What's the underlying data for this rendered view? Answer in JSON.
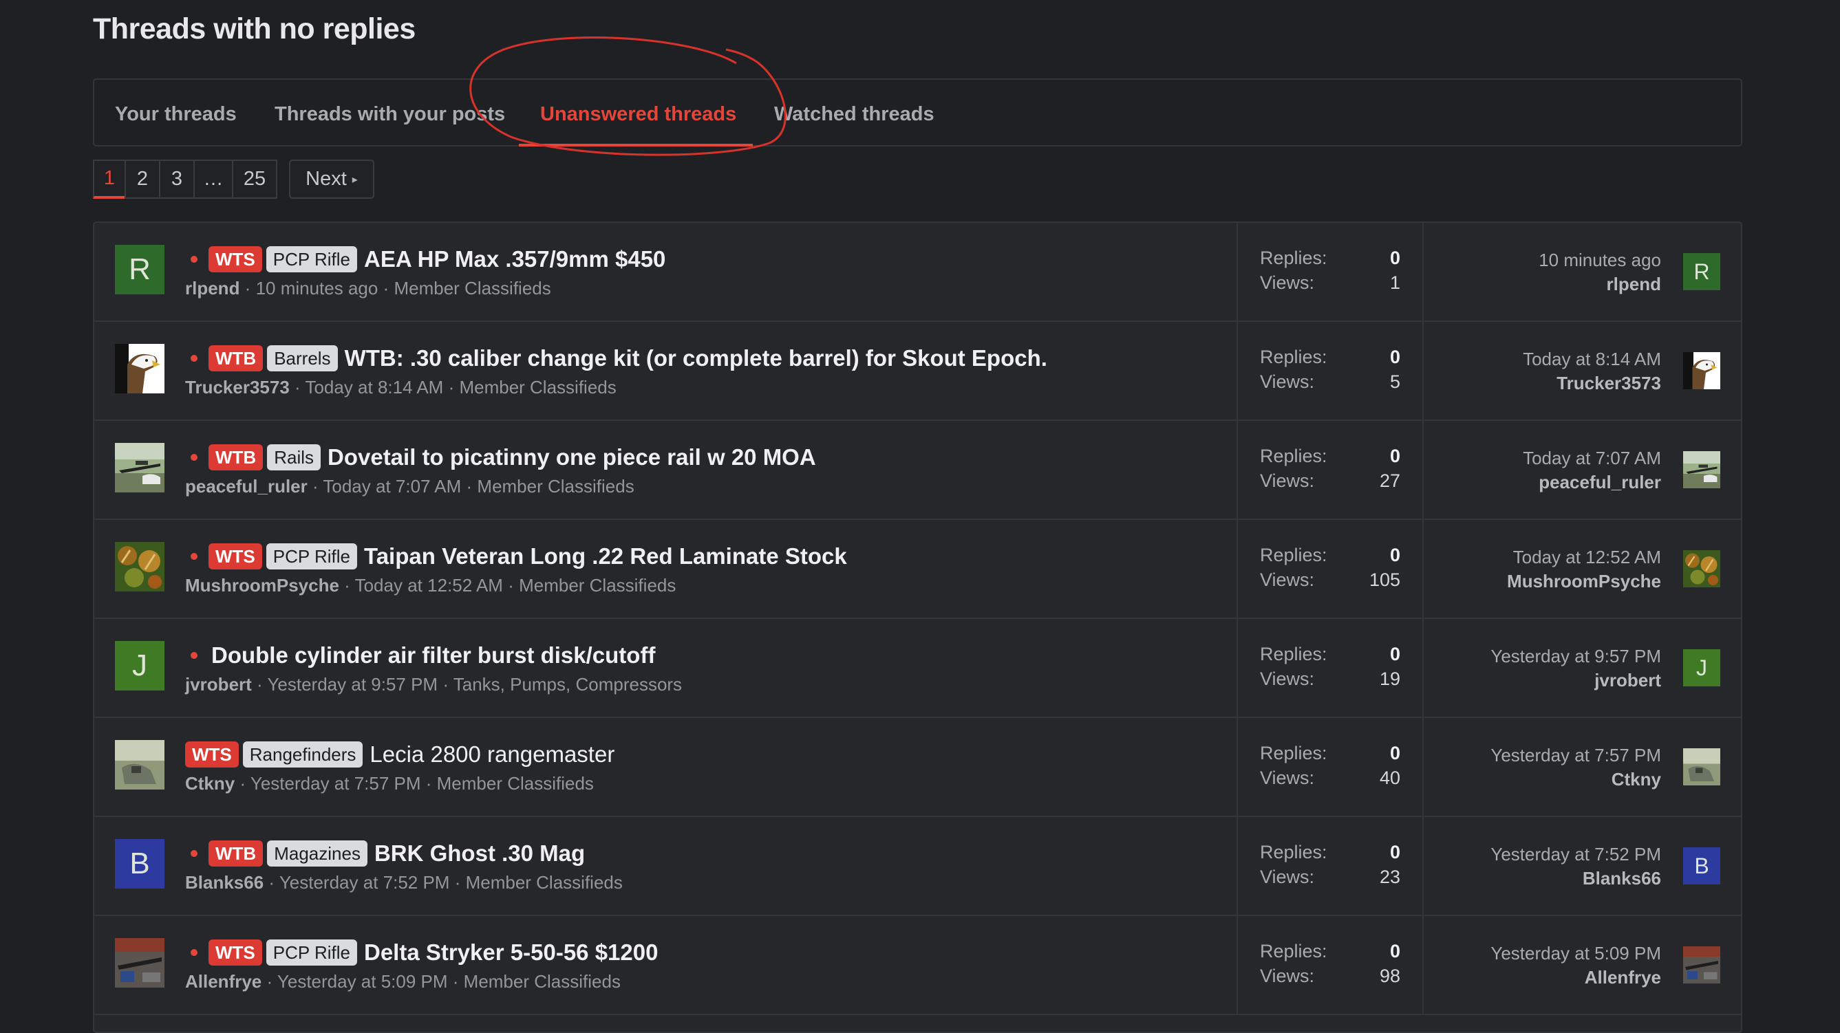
{
  "page": {
    "title": "Threads with no replies"
  },
  "tabs": [
    {
      "label": "Your threads"
    },
    {
      "label": "Threads with your posts"
    },
    {
      "label": "Unanswered threads",
      "active": true
    },
    {
      "label": "Watched threads"
    }
  ],
  "pagination": {
    "pages": [
      "1",
      "2",
      "3",
      "…",
      "25"
    ],
    "current": "1",
    "next_label": "Next",
    "next_icon": "chevron-right-icon"
  },
  "colors": {
    "accent": "#e5463a",
    "background": "#1f2024",
    "panel": "#26272b",
    "badge_red": "#dc3b33",
    "badge_grey": "#d9dbde"
  },
  "stats_labels": {
    "replies": "Replies:",
    "views": "Views:"
  },
  "threads": [
    {
      "avatar_letter": "R",
      "avatar_color": "#2e6a2a",
      "unread": true,
      "prefix": "WTS",
      "tag": "PCP Rifle",
      "title": "AEA HP Max .357/9mm $450",
      "author": "rlpend",
      "time": "10 minutes ago",
      "forum": "Member Classifieds",
      "replies": "0",
      "views": "1",
      "last_time": "10 minutes ago",
      "last_user": "rlpend"
    },
    {
      "avatar_image": "eagle",
      "unread": true,
      "prefix": "WTB",
      "tag": "Barrels",
      "title": "WTB: .30 caliber change kit (or complete barrel) for Skout Epoch.",
      "author": "Trucker3573",
      "time": "Today at 8:14 AM",
      "forum": "Member Classifieds",
      "replies": "0",
      "views": "5",
      "last_time": "Today at 8:14 AM",
      "last_user": "Trucker3573"
    },
    {
      "avatar_image": "rifle-outdoor",
      "unread": true,
      "prefix": "WTB",
      "tag": "Rails",
      "title": "Dovetail to picatinny one piece rail w 20 MOA",
      "author": "peaceful_ruler",
      "time": "Today at 7:07 AM",
      "forum": "Member Classifieds",
      "replies": "0",
      "views": "27",
      "last_time": "Today at 7:07 AM",
      "last_user": "peaceful_ruler"
    },
    {
      "avatar_image": "plant",
      "unread": true,
      "prefix": "WTS",
      "tag": "PCP Rifle",
      "title": "Taipan Veteran Long .22 Red Laminate Stock",
      "author": "MushroomPsyche",
      "time": "Today at 12:52 AM",
      "forum": "Member Classifieds",
      "replies": "0",
      "views": "105",
      "last_time": "Today at 12:52 AM",
      "last_user": "MushroomPsyche"
    },
    {
      "avatar_letter": "J",
      "avatar_color": "#3f7a24",
      "unread": true,
      "prefix": "",
      "tag": "",
      "title": "Double cylinder air filter burst disk/cutoff",
      "author": "jvrobert",
      "time": "Yesterday at 9:57 PM",
      "forum": "Tanks, Pumps, Compressors",
      "replies": "0",
      "views": "19",
      "last_time": "Yesterday at 9:57 PM",
      "last_user": "jvrobert"
    },
    {
      "avatar_image": "landscape",
      "unread": false,
      "prefix": "WTS",
      "tag": "Rangefinders",
      "title": "Lecia 2800 rangemaster",
      "author": "Ctkny",
      "time": "Yesterday at 7:57 PM",
      "forum": "Member Classifieds",
      "replies": "0",
      "views": "40",
      "last_time": "Yesterday at 7:57 PM",
      "last_user": "Ctkny"
    },
    {
      "avatar_letter": "B",
      "avatar_color": "#2d3aa0",
      "unread": true,
      "prefix": "WTB",
      "tag": "Magazines",
      "title": "BRK Ghost .30 Mag",
      "author": "Blanks66",
      "time": "Yesterday at 7:52 PM",
      "forum": "Member Classifieds",
      "replies": "0",
      "views": "23",
      "last_time": "Yesterday at 7:52 PM",
      "last_user": "Blanks66"
    },
    {
      "avatar_image": "workshop",
      "unread": true,
      "prefix": "WTS",
      "tag": "PCP Rifle",
      "title": "Delta Stryker 5-50-56 $1200",
      "author": "Allenfrye",
      "time": "Yesterday at 5:09 PM",
      "forum": "Member Classifieds",
      "replies": "0",
      "views": "98",
      "last_time": "Yesterday at 5:09 PM",
      "last_user": "Allenfrye"
    }
  ]
}
